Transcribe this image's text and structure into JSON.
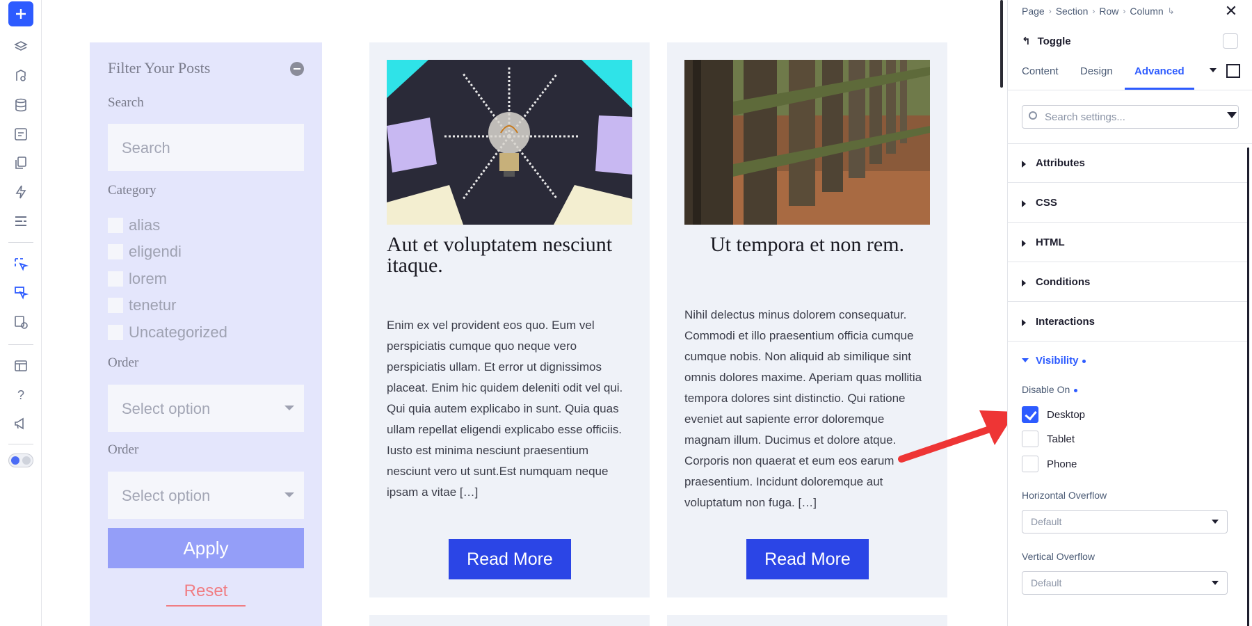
{
  "rail": {
    "icons": [
      "plus-icon",
      "layers-icon",
      "paint-icon",
      "database-icon",
      "form-icon",
      "copy-icon",
      "bolt-icon",
      "list-icon",
      "pointer-icon",
      "pointer-alt-icon",
      "visibility-icon",
      "window-icon",
      "help-icon",
      "megaphone-icon"
    ],
    "help_label": "?"
  },
  "filter": {
    "title": "Filter Your Posts",
    "search_label": "Search",
    "search_placeholder": "Search",
    "category_label": "Category",
    "categories": [
      "alias",
      "eligendi",
      "lorem",
      "tenetur",
      "Uncategorized"
    ],
    "order_label_1": "Order",
    "order_placeholder_1": "Select option",
    "order_label_2": "Order",
    "order_placeholder_2": "Select option",
    "apply": "Apply",
    "reset": "Reset"
  },
  "posts": [
    {
      "title": "Aut et voluptatem nesciunt itaque.",
      "excerpt": "Enim ex vel provident eos quo. Eum vel perspiciatis cumque quo neque vero perspiciatis ullam. Et error ut dignissimos placeat. Enim hic quidem deleniti odit vel qui. Qui quia autem explicabo in sunt. Quia quas ullam repellat eligendi explicabo esse officiis. Iusto est minima nesciunt praesentium nesciunt vero ut sunt.Est numquam neque ipsam a vitae […]",
      "button": "Read More"
    },
    {
      "title": "Ut tempora et non rem.",
      "excerpt": "Nihil delectus minus dolorem consequatur. Commodi et illo praesentium officia cumque cumque nobis. Non aliquid ab similique sint omnis dolores maxime. Aperiam quas mollitia tempora dolores sint distinctio. Qui ratione eveniet aut sapiente error doloremque magnam illum. Ducimus et dolore atque. Corporis non quaerat et eum eos earum praesentium. Incidunt doloremque aut voluptatum non fuga. […]",
      "button": "Read More"
    }
  ],
  "panel": {
    "breadcrumb": [
      "Page",
      "Section",
      "Row",
      "Column"
    ],
    "element_name": "Toggle",
    "tabs": [
      "Content",
      "Design",
      "Advanced"
    ],
    "active_tab": "Advanced",
    "search_placeholder": "Search settings...",
    "sections": [
      "Attributes",
      "CSS",
      "HTML",
      "Conditions",
      "Interactions"
    ],
    "visibility": {
      "title": "Visibility",
      "disable_on_label": "Disable On",
      "options": [
        {
          "label": "Desktop",
          "checked": true
        },
        {
          "label": "Tablet",
          "checked": false
        },
        {
          "label": "Phone",
          "checked": false
        }
      ],
      "horizontal_overflow_label": "Horizontal Overflow",
      "horizontal_overflow_value": "Default",
      "vertical_overflow_label": "Vertical Overflow",
      "vertical_overflow_value": "Default"
    }
  },
  "colors": {
    "accent": "#2d5bff",
    "annotation_arrow": "#ee3535",
    "filter_bg": "#e4e6fc",
    "read_more": "#2b45e6"
  }
}
